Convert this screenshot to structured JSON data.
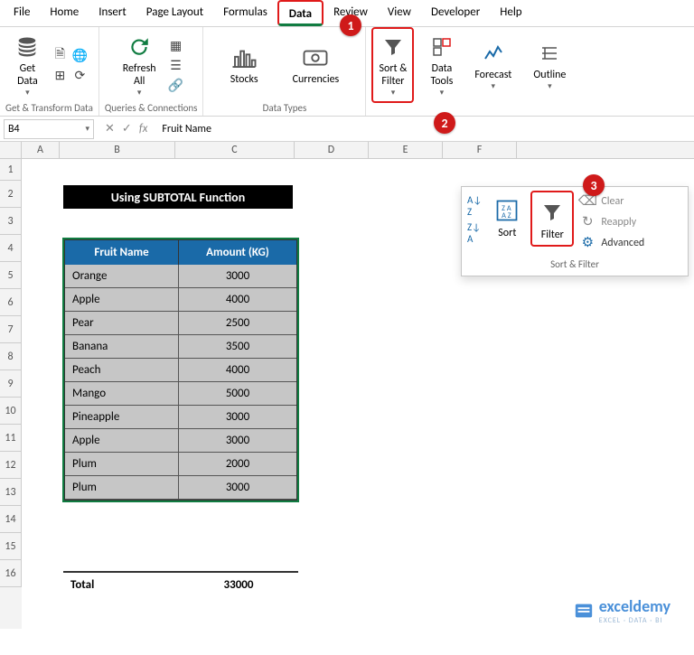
{
  "menu": {
    "items": [
      "File",
      "Home",
      "Insert",
      "Page Layout",
      "Formulas",
      "Data",
      "Review",
      "View",
      "Developer",
      "Help"
    ],
    "active": "Data"
  },
  "ribbon": {
    "get_data": "Get\nData",
    "refresh_all": "Refresh\nAll",
    "stocks": "Stocks",
    "currencies": "Currencies",
    "sort_filter": "Sort &\nFilter",
    "data_tools": "Data\nTools",
    "forecast": "Forecast",
    "outline": "Outline",
    "group_labels": {
      "get": "Get & Transform Data",
      "queries": "Queries & Connections",
      "types": "Data Types"
    }
  },
  "namebox": "B4",
  "formula": "Fruit Name",
  "columns": [
    "A",
    "B",
    "C",
    "D",
    "E",
    "F"
  ],
  "rows": [
    "1",
    "2",
    "3",
    "4",
    "5",
    "6",
    "7",
    "8",
    "9",
    "10",
    "11",
    "12",
    "13",
    "14",
    "15",
    "16"
  ],
  "title": "Using SUBTOTAL Function",
  "table": {
    "h1": "Fruit Name",
    "h2": "Amount (KG)",
    "data": [
      {
        "name": "Orange",
        "amt": "3000"
      },
      {
        "name": "Apple",
        "amt": "4000"
      },
      {
        "name": "Pear",
        "amt": "2500"
      },
      {
        "name": "Banana",
        "amt": "3500"
      },
      {
        "name": "Peach",
        "amt": "4000"
      },
      {
        "name": "Mango",
        "amt": "5000"
      },
      {
        "name": "Pineapple",
        "amt": "3000"
      },
      {
        "name": "Apple",
        "amt": "3000"
      },
      {
        "name": "Plum",
        "amt": "2000"
      },
      {
        "name": "Plum",
        "amt": "3000"
      }
    ]
  },
  "total": {
    "label": "Total",
    "value": "33000"
  },
  "dropdown": {
    "sort": "Sort",
    "filter": "Filter",
    "clear": "Clear",
    "reapply": "Reapply",
    "advanced": "Advanced",
    "label": "Sort & Filter"
  },
  "badges": {
    "b1": "1",
    "b2": "2",
    "b3": "3"
  },
  "watermark": {
    "name": "exceldemy",
    "tag": "EXCEL · DATA · BI"
  }
}
